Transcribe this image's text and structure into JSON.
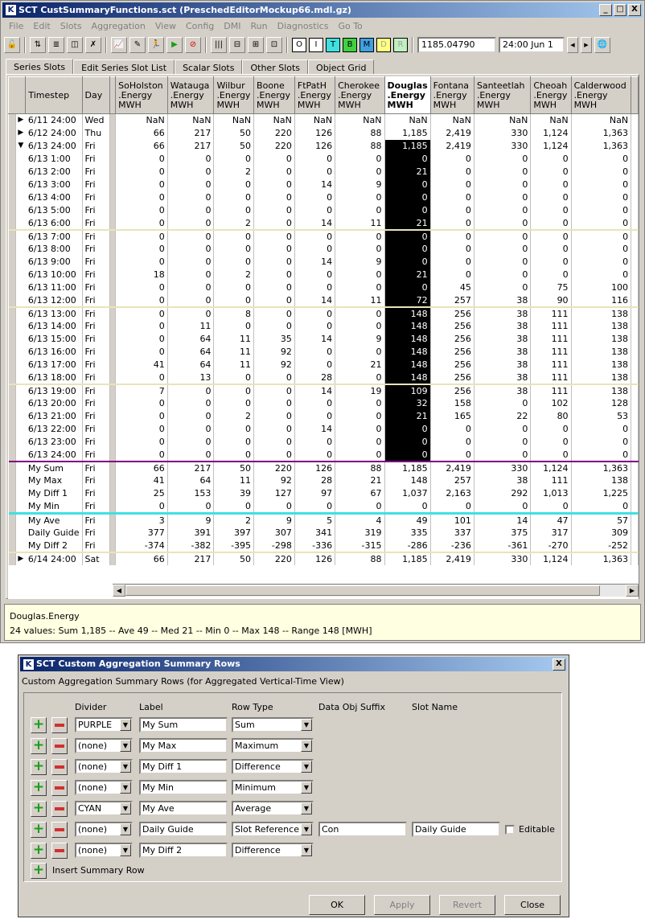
{
  "window": {
    "title": "SCT CustSummaryFunctions.sct (PreschedEditorMockup66.mdl.gz)",
    "minimize": "_",
    "maximize": "□",
    "close": "X"
  },
  "menu": [
    "File",
    "Edit",
    "Slots",
    "Aggregation",
    "View",
    "Config",
    "DMI",
    "Run",
    "Diagnostics",
    "Go To"
  ],
  "toolbar": {
    "value_field": "1185.04790",
    "date_field": "24:00 Jun 1",
    "letters": [
      "O",
      "I",
      "T",
      "B",
      "M",
      "D",
      "R"
    ]
  },
  "tabs": [
    "Series Slots",
    "Edit Series Slot List",
    "Scalar Slots",
    "Other Slots",
    "Object Grid"
  ],
  "grid": {
    "timestep_header": "Timestep",
    "day_header": "Day",
    "columns": [
      {
        "l1": "SoHolston",
        "l2": ".Energy",
        "l3": "MWH"
      },
      {
        "l1": "Watauga",
        "l2": ".Energy",
        "l3": "MWH"
      },
      {
        "l1": "Wilbur",
        "l2": ".Energy",
        "l3": "MWH"
      },
      {
        "l1": "Boone",
        "l2": ".Energy",
        "l3": "MWH"
      },
      {
        "l1": "FtPatH",
        "l2": ".Energy",
        "l3": "MWH"
      },
      {
        "l1": "Cherokee",
        "l2": ".Energy",
        "l3": "MWH"
      },
      {
        "l1": "Douglas",
        "l2": ".Energy",
        "l3": "MWH"
      },
      {
        "l1": "Fontana",
        "l2": ".Energy",
        "l3": "MWH"
      },
      {
        "l1": "Santeetlah",
        "l2": ".Energy",
        "l3": "MWH"
      },
      {
        "l1": "Cheoah",
        "l2": ".Energy",
        "l3": "MWH"
      },
      {
        "l1": "Calderwood",
        "l2": ".Energy",
        "l3": "MWH"
      }
    ],
    "rows": [
      {
        "ts": "6/11 24:00",
        "day": "Wed",
        "mark": "▶",
        "v": [
          "NaN",
          "NaN",
          "NaN",
          "NaN",
          "NaN",
          "NaN",
          "NaN",
          "NaN",
          "NaN",
          "NaN",
          "NaN"
        ]
      },
      {
        "ts": "6/12 24:00",
        "day": "Thu",
        "mark": "▶",
        "v": [
          "66",
          "217",
          "50",
          "220",
          "126",
          "88",
          "1,185",
          "2,419",
          "330",
          "1,124",
          "1,363"
        ]
      },
      {
        "ts": "6/13 24:00",
        "day": "Fri",
        "mark": "▼",
        "v": [
          "66",
          "217",
          "50",
          "220",
          "126",
          "88",
          "1,185",
          "2,419",
          "330",
          "1,124",
          "1,363"
        ]
      },
      {
        "ts": "6/13 1:00",
        "day": "Fri",
        "v": [
          "0",
          "0",
          "0",
          "0",
          "0",
          "0",
          "0",
          "0",
          "0",
          "0",
          "0"
        ]
      },
      {
        "ts": "6/13 2:00",
        "day": "Fri",
        "v": [
          "0",
          "0",
          "2",
          "0",
          "0",
          "0",
          "21",
          "0",
          "0",
          "0",
          "0"
        ]
      },
      {
        "ts": "6/13 3:00",
        "day": "Fri",
        "v": [
          "0",
          "0",
          "0",
          "0",
          "14",
          "9",
          "0",
          "0",
          "0",
          "0",
          "0"
        ]
      },
      {
        "ts": "6/13 4:00",
        "day": "Fri",
        "v": [
          "0",
          "0",
          "0",
          "0",
          "0",
          "0",
          "0",
          "0",
          "0",
          "0",
          "0"
        ]
      },
      {
        "ts": "6/13 5:00",
        "day": "Fri",
        "v": [
          "0",
          "0",
          "0",
          "0",
          "0",
          "0",
          "0",
          "0",
          "0",
          "0",
          "0"
        ]
      },
      {
        "ts": "6/13 6:00",
        "day": "Fri",
        "v": [
          "0",
          "0",
          "2",
          "0",
          "14",
          "11",
          "21",
          "0",
          "0",
          "0",
          "0"
        ]
      },
      {
        "ts": "6/13 7:00",
        "day": "Fri",
        "blk": true,
        "v": [
          "0",
          "0",
          "0",
          "0",
          "0",
          "0",
          "0",
          "0",
          "0",
          "0",
          "0"
        ]
      },
      {
        "ts": "6/13 8:00",
        "day": "Fri",
        "v": [
          "0",
          "0",
          "0",
          "0",
          "0",
          "0",
          "0",
          "0",
          "0",
          "0",
          "0"
        ]
      },
      {
        "ts": "6/13 9:00",
        "day": "Fri",
        "v": [
          "0",
          "0",
          "0",
          "0",
          "14",
          "9",
          "0",
          "0",
          "0",
          "0",
          "0"
        ]
      },
      {
        "ts": "6/13 10:00",
        "day": "Fri",
        "v": [
          "18",
          "0",
          "2",
          "0",
          "0",
          "0",
          "21",
          "0",
          "0",
          "0",
          "0"
        ]
      },
      {
        "ts": "6/13 11:00",
        "day": "Fri",
        "v": [
          "0",
          "0",
          "0",
          "0",
          "0",
          "0",
          "0",
          "45",
          "0",
          "75",
          "100"
        ]
      },
      {
        "ts": "6/13 12:00",
        "day": "Fri",
        "v": [
          "0",
          "0",
          "0",
          "0",
          "14",
          "11",
          "72",
          "257",
          "38",
          "90",
          "116"
        ]
      },
      {
        "ts": "6/13 13:00",
        "day": "Fri",
        "blk": true,
        "v": [
          "0",
          "0",
          "8",
          "0",
          "0",
          "0",
          "148",
          "256",
          "38",
          "111",
          "138"
        ]
      },
      {
        "ts": "6/13 14:00",
        "day": "Fri",
        "v": [
          "0",
          "11",
          "0",
          "0",
          "0",
          "0",
          "148",
          "256",
          "38",
          "111",
          "138"
        ]
      },
      {
        "ts": "6/13 15:00",
        "day": "Fri",
        "v": [
          "0",
          "64",
          "11",
          "35",
          "14",
          "9",
          "148",
          "256",
          "38",
          "111",
          "138"
        ]
      },
      {
        "ts": "6/13 16:00",
        "day": "Fri",
        "v": [
          "0",
          "64",
          "11",
          "92",
          "0",
          "0",
          "148",
          "256",
          "38",
          "111",
          "138"
        ]
      },
      {
        "ts": "6/13 17:00",
        "day": "Fri",
        "v": [
          "41",
          "64",
          "11",
          "92",
          "0",
          "21",
          "148",
          "256",
          "38",
          "111",
          "138"
        ]
      },
      {
        "ts": "6/13 18:00",
        "day": "Fri",
        "v": [
          "0",
          "13",
          "0",
          "0",
          "28",
          "0",
          "148",
          "256",
          "38",
          "111",
          "138"
        ]
      },
      {
        "ts": "6/13 19:00",
        "day": "Fri",
        "blk": true,
        "v": [
          "7",
          "0",
          "0",
          "0",
          "14",
          "19",
          "109",
          "256",
          "38",
          "111",
          "138"
        ]
      },
      {
        "ts": "6/13 20:00",
        "day": "Fri",
        "v": [
          "0",
          "0",
          "0",
          "0",
          "0",
          "0",
          "32",
          "158",
          "0",
          "102",
          "128"
        ]
      },
      {
        "ts": "6/13 21:00",
        "day": "Fri",
        "v": [
          "0",
          "0",
          "2",
          "0",
          "0",
          "0",
          "21",
          "165",
          "22",
          "80",
          "53"
        ]
      },
      {
        "ts": "6/13 22:00",
        "day": "Fri",
        "v": [
          "0",
          "0",
          "0",
          "0",
          "14",
          "0",
          "0",
          "0",
          "0",
          "0",
          "0"
        ]
      },
      {
        "ts": "6/13 23:00",
        "day": "Fri",
        "v": [
          "0",
          "0",
          "0",
          "0",
          "0",
          "0",
          "0",
          "0",
          "0",
          "0",
          "0"
        ]
      },
      {
        "ts": "6/13 24:00",
        "day": "Fri",
        "v": [
          "0",
          "0",
          "0",
          "0",
          "0",
          "0",
          "0",
          "0",
          "0",
          "0",
          "0"
        ]
      },
      {
        "ts": "My Sum",
        "day": "Fri",
        "div": "purple",
        "v": [
          "66",
          "217",
          "50",
          "220",
          "126",
          "88",
          "1,185",
          "2,419",
          "330",
          "1,124",
          "1,363"
        ]
      },
      {
        "ts": "My Max",
        "day": "Fri",
        "v": [
          "41",
          "64",
          "11",
          "92",
          "28",
          "21",
          "148",
          "257",
          "38",
          "111",
          "138"
        ]
      },
      {
        "ts": "My Diff 1",
        "day": "Fri",
        "v": [
          "25",
          "153",
          "39",
          "127",
          "97",
          "67",
          "1,037",
          "2,163",
          "292",
          "1,013",
          "1,225"
        ]
      },
      {
        "ts": "My Min",
        "day": "Fri",
        "v": [
          "0",
          "0",
          "0",
          "0",
          "0",
          "0",
          "0",
          "0",
          "0",
          "0",
          "0"
        ]
      },
      {
        "ts": "My Ave",
        "day": "Fri",
        "div": "cyan",
        "v": [
          "3",
          "9",
          "2",
          "9",
          "5",
          "4",
          "49",
          "101",
          "14",
          "47",
          "57"
        ]
      },
      {
        "ts": "Daily Guide",
        "day": "Fri",
        "v": [
          "377",
          "391",
          "397",
          "307",
          "341",
          "319",
          "335",
          "337",
          "375",
          "317",
          "309"
        ]
      },
      {
        "ts": "My Diff 2",
        "day": "Fri",
        "v": [
          "-374",
          "-382",
          "-395",
          "-298",
          "-336",
          "-315",
          "-286",
          "-236",
          "-361",
          "-270",
          "-252"
        ]
      },
      {
        "ts": "6/14 24:00",
        "day": "Sat",
        "mark": "▶",
        "blk": true,
        "v": [
          "66",
          "217",
          "50",
          "220",
          "126",
          "88",
          "1,185",
          "2,419",
          "330",
          "1,124",
          "1,363"
        ]
      }
    ]
  },
  "status": {
    "slot": "Douglas.Energy",
    "summary": "24 values:  Sum 1,185 -- Ave 49 -- Med 21 -- Min 0 -- Max 148 -- Range 148 [MWH]"
  },
  "dialog": {
    "title": "SCT Custom Aggregation Summary Rows",
    "close": "X",
    "subtitle": "Custom Aggregation Summary Rows (for Aggregated Vertical-Time View)",
    "headers": {
      "divider": "Divider",
      "label": "Label",
      "row_type": "Row Type",
      "suffix": "Data Obj Suffix",
      "slot": "Slot Name"
    },
    "rows": [
      {
        "divider": "PURPLE",
        "label": "My Sum",
        "type": "Sum"
      },
      {
        "divider": "(none)",
        "label": "My Max",
        "type": "Maximum"
      },
      {
        "divider": "(none)",
        "label": "My Diff 1",
        "type": "Difference"
      },
      {
        "divider": "(none)",
        "label": "My Min",
        "type": "Minimum"
      },
      {
        "divider": "CYAN",
        "label": "My Ave",
        "type": "Average"
      },
      {
        "divider": "(none)",
        "label": "Daily Guide",
        "type": "Slot Reference",
        "suffix": "Con",
        "slot": "Daily Guide",
        "editable": "Editable"
      },
      {
        "divider": "(none)",
        "label": "My Diff 2",
        "type": "Difference"
      }
    ],
    "insert_label": "Insert Summary Row",
    "buttons": {
      "ok": "OK",
      "apply": "Apply",
      "revert": "Revert",
      "close": "Close"
    }
  }
}
